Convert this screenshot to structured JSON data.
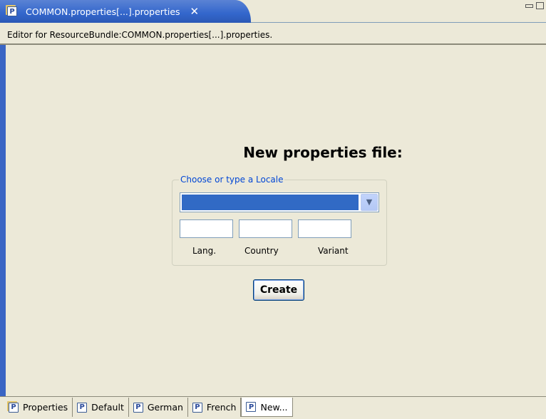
{
  "editor_tab": {
    "label": "COMMON.properties[...].properties",
    "close": "✕"
  },
  "description": "Editor for ResourceBundle:COMMON.properties[...].properties.",
  "form": {
    "title": "New properties file:",
    "group_label": "Choose or type a Locale",
    "combo_value": "",
    "lang_value": "",
    "country_value": "",
    "variant_value": "",
    "lang_label": "Lang.",
    "country_label": "Country",
    "variant_label": "Variant",
    "create_label": "Create"
  },
  "page_tabs": [
    {
      "label": "Properties",
      "icon": "properties-stack-icon"
    },
    {
      "label": "Default",
      "icon": "properties-file-icon"
    },
    {
      "label": "German",
      "icon": "properties-file-icon"
    },
    {
      "label": "French",
      "icon": "properties-file-icon"
    },
    {
      "label": "New...",
      "icon": "new-properties-file-icon",
      "active": true
    }
  ],
  "colors": {
    "tab_active": "#3366cc",
    "background": "#ece9d8",
    "selection": "#316ac5",
    "group_label": "#0046d5"
  }
}
